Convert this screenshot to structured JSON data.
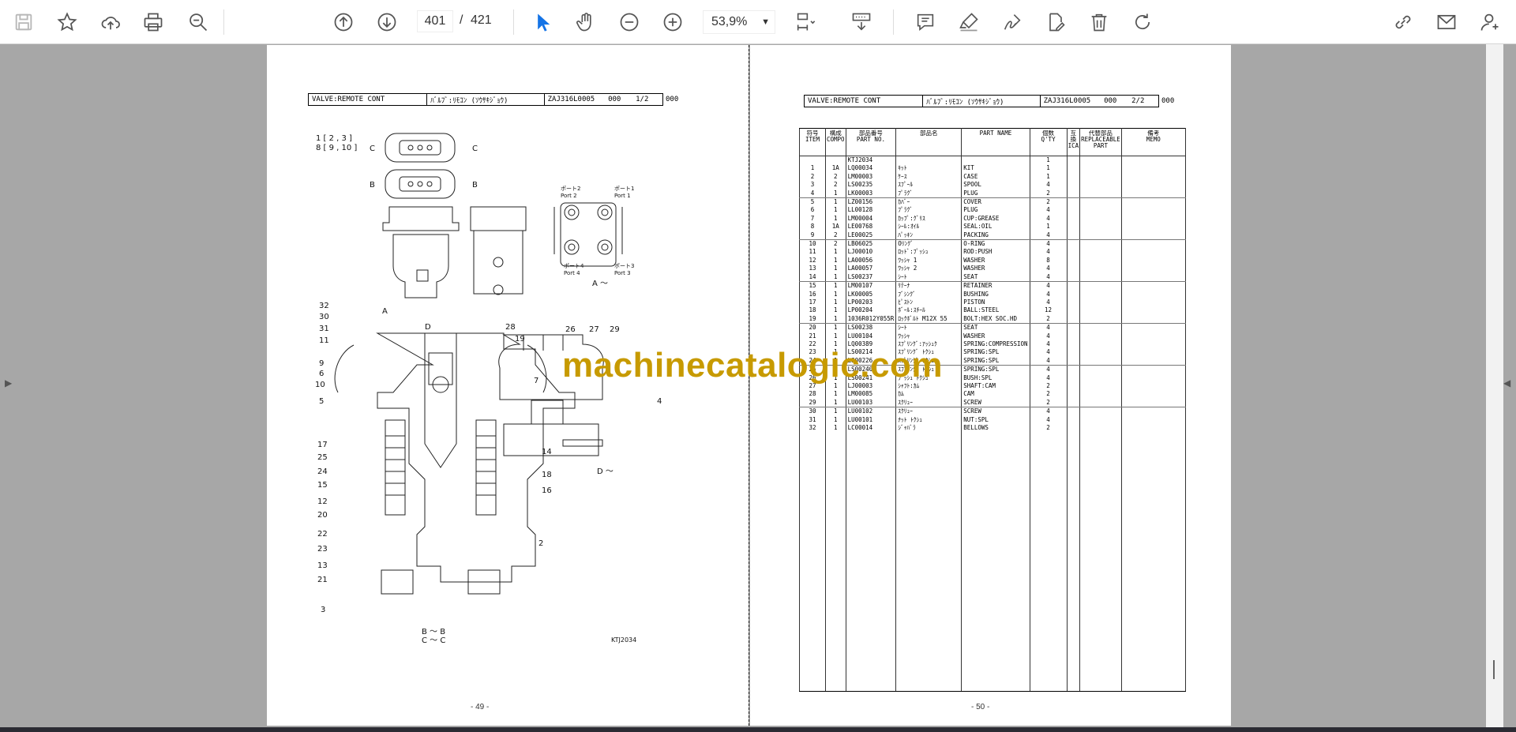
{
  "toolbar": {
    "page_current": "401",
    "page_separator": "/",
    "page_total": "421",
    "zoom": "53,9%",
    "icons": [
      "save-icon",
      "star-icon",
      "upload-icon",
      "print-icon",
      "zoom-search-icon",
      "page-up-icon",
      "page-down-icon",
      "select-cursor-icon",
      "hand-icon",
      "zoom-out-icon",
      "zoom-in-icon",
      "page-fit-icon",
      "scroll-mode-icon",
      "comment-icon",
      "highlight-icon",
      "sign-icon",
      "fill-sign-icon",
      "delete-icon",
      "rotate-icon",
      "share-link-icon",
      "email-icon",
      "account-icon"
    ]
  },
  "watermark": "machinecatalogic.com",
  "left_page": {
    "header": {
      "title": "VALVE:REMOTE CONT",
      "jp": "ﾊﾞﾙﾌﾞ:ﾘﾓｺﾝ (ｿｳｻｷｼﾞｮｳ)",
      "code": "ZAJ316L0005",
      "rev": "000",
      "sheet": "1/2",
      "extra": "000"
    },
    "page_number": "- 49 -",
    "diagram_code": "KTJ2034",
    "labels": {
      "top_left_1": "1 [ 2 , 3 ]",
      "top_left_2": "8 [ 9 , 10 ]",
      "sec_c": "C",
      "sec_b": "B",
      "sec_a": "A",
      "sec_d": "D",
      "port2_jp": "ポート2",
      "port2": "Port 2",
      "port1_jp": "ポート1",
      "port1": "Port 1",
      "port4_jp": "ポート4",
      "port4": "Port 4",
      "port3_jp": "ポート3",
      "port3": "Port 3",
      "view_a": "A ～",
      "view_d": "D ～",
      "view_bb": "B ～ B",
      "view_cc": "C ～ C",
      "callouts_left": [
        "32",
        "30",
        "31",
        "11",
        "9",
        "6",
        "10",
        "5",
        "17",
        "25",
        "24",
        "15",
        "12",
        "20",
        "22",
        "23",
        "13",
        "21",
        "3"
      ],
      "callouts_right": [
        "28",
        "19",
        "7",
        "14",
        "18",
        "16",
        "2"
      ],
      "callouts_d": [
        "26",
        "27",
        "29",
        "4"
      ]
    }
  },
  "right_page": {
    "header": {
      "title": "VALVE:REMOTE CONT",
      "jp": "ﾊﾞﾙﾌﾞ:ﾘﾓｺﾝ (ｿｳｻｷｼﾞｮｳ)",
      "code": "ZAJ316L0005",
      "rev": "000",
      "sheet": "2/2",
      "extra": "000"
    },
    "page_number": "- 50 -",
    "table": {
      "columns": [
        "符号\nITEM",
        "構成\nCOMPO",
        "部品番号\nPART NO.",
        "部品名",
        "PART NAME",
        "個数\nQ'TY",
        "互換\nICA",
        "代替部品\nREPLACEABLE\nPART",
        "備考\nMEMO"
      ],
      "rows": [
        [
          "",
          "",
          "KTJ2034",
          "",
          "",
          "1"
        ],
        [
          "1",
          "1A",
          "LQ00034",
          "ｷｯﾄ",
          "KIT",
          "1"
        ],
        [
          "2",
          "2",
          "LM00003",
          "ｹｰｽ",
          "CASE",
          "1"
        ],
        [
          "3",
          "2",
          "LS00235",
          "ｽﾌﾟｰﾙ",
          "SPOOL",
          "4"
        ],
        [
          "4",
          "1",
          "LK00003",
          "ﾌﾟﾗｸﾞ",
          "PLUG",
          "2"
        ],
        [
          "5",
          "1",
          "LZ00156",
          "ｶﾊﾞｰ",
          "COVER",
          "2"
        ],
        [
          "6",
          "1",
          "LL00128",
          "ﾌﾟﾗｸﾞ",
          "PLUG",
          "4"
        ],
        [
          "7",
          "1",
          "LM00004",
          "ｶｯﾌﾟ:ｸﾞﾘｽ",
          "CUP:GREASE",
          "4"
        ],
        [
          "8",
          "1A",
          "LE00768",
          "ｼｰﾙ:ｵｲﾙ",
          "SEAL:OIL",
          "1"
        ],
        [
          "9",
          "2",
          "LE00025",
          "ﾊﾟｯｷﾝ",
          "PACKING",
          "4"
        ],
        [
          "10",
          "2",
          "LB06025",
          "Oﾘﾝｸﾞ",
          "O-RING",
          "4"
        ],
        [
          "11",
          "1",
          "LJ00010",
          "ﾛｯﾄﾞ:ﾌﾟｯｼｭ",
          "ROD:PUSH",
          "4"
        ],
        [
          "12",
          "1",
          "LA00056",
          "ﾜｯｼｬ 1",
          "WASHER",
          "8"
        ],
        [
          "13",
          "1",
          "LA00057",
          "ﾜｯｼｬ 2",
          "WASHER",
          "4"
        ],
        [
          "14",
          "1",
          "LS00237",
          "ｼｰﾄ",
          "SEAT",
          "4"
        ],
        [
          "15",
          "1",
          "LM00107",
          "ﾘﾃｰﾅ",
          "RETAINER",
          "4"
        ],
        [
          "16",
          "1",
          "LK00005",
          "ﾌﾞｼﾝｸﾞ",
          "BUSHING",
          "4"
        ],
        [
          "17",
          "1",
          "LP00203",
          "ﾋﾟｽﾄﾝ",
          "PISTON",
          "4"
        ],
        [
          "18",
          "1",
          "LP00204",
          "ﾎﾞｰﾙ:ｽﾁｰﾙ",
          "BALL:STEEL",
          "12"
        ],
        [
          "19",
          "1",
          "1036R012Y055R",
          "ﾛｯｸﾎﾞﾙﾄ M12X 55",
          "BOLT:HEX SOC.HD",
          "2"
        ],
        [
          "20",
          "1",
          "LS00238",
          "ｼｰﾄ",
          "SEAT",
          "4"
        ],
        [
          "21",
          "1",
          "LU00104",
          "ﾜｯｼｬ",
          "WASHER",
          "4"
        ],
        [
          "22",
          "1",
          "LQ00389",
          "ｽﾌﾟﾘﾝｸﾞ:ｱｯｼｭｸ",
          "SPRING:COMPRESSION",
          "4"
        ],
        [
          "23",
          "1",
          "LS00214",
          "ｽﾌﾟﾘﾝｸﾞ ﾄｸｼｭ",
          "SPRING:SPL",
          "4"
        ],
        [
          "24",
          "1",
          "LS00226",
          "ｽﾌﾟﾘﾝｸﾞ ﾄｸｼｭ",
          "SPRING:SPL",
          "4"
        ],
        [
          "25",
          "1",
          "LS00240",
          "ｽﾌﾟﾘﾝｸﾞ ﾄｸｼｭ",
          "SPRING:SPL",
          "4"
        ],
        [
          "26",
          "1",
          "LS00241",
          "ﾌﾞｯｼｭ ﾄｸｼｭ",
          "BUSH:SPL",
          "4"
        ],
        [
          "27",
          "1",
          "LJ00003",
          "ｼｬﾌﾄ:ｶﾑ",
          "SHAFT:CAM",
          "2"
        ],
        [
          "28",
          "1",
          "LM00085",
          "ｶﾑ",
          "CAM",
          "2"
        ],
        [
          "29",
          "1",
          "LU00103",
          "ｽｸﾘｭｰ",
          "SCREW",
          "2"
        ],
        [
          "30",
          "1",
          "LU00102",
          "ｽｸﾘｭｰ",
          "SCREW",
          "4"
        ],
        [
          "31",
          "1",
          "LU00101",
          "ﾅｯﾄ ﾄｸｼｭ",
          "NUT:SPL",
          "4"
        ],
        [
          "32",
          "1",
          "LC00014",
          "ｼﾞｬﾊﾞﾗ",
          "BELLOWS",
          "2"
        ]
      ]
    }
  },
  "colors": {
    "toolbar_bg": "#ffffff",
    "viewport_bg": "#a7a7a7",
    "watermark": "#c79a00",
    "select_cursor": "#1473e6"
  }
}
